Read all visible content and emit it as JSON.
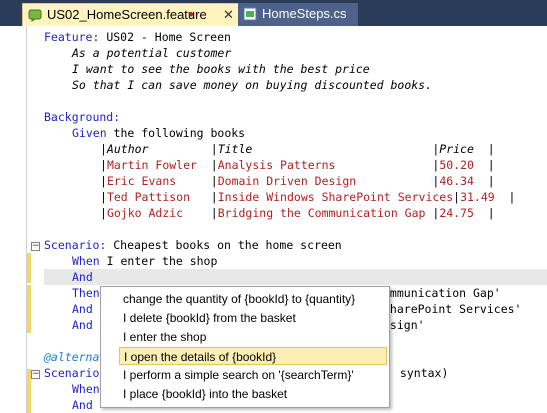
{
  "tabs": [
    {
      "label": "US02_HomeScreen.feature",
      "dirty_marker": "●",
      "close": "✕"
    },
    {
      "label": "HomeSteps.cs"
    }
  ],
  "editor": {
    "lines": [
      {
        "k1": "Feature:",
        "t1": " US02 - Home Screen"
      },
      {
        "t1": "As a potential customer"
      },
      {
        "t1": "I want to see the books with the best price"
      },
      {
        "t1": "So that I can save money on buying discounted books."
      },
      {
        "k1": "Background:"
      },
      {
        "k1": "Given",
        "t1": " the following books"
      },
      {
        "row": "|Author         |Title                          |Price  |"
      },
      {
        "r1": "Martin Fowler  ",
        "r2": "Analysis Patterns              ",
        "r3": "50.20  "
      },
      {
        "r1": "Eric Evans     ",
        "r2": "Domain Driven Design           ",
        "r3": "46.34  "
      },
      {
        "r1": "Ted Pattison   ",
        "r2": "Inside Windows SharePoint Services",
        "r3": "31.49  "
      },
      {
        "r1": "Gojko Adzic    ",
        "r2": "Bridging the Communication Gap ",
        "r3": "24.75  "
      },
      {
        "k1": "Scenario:",
        "t1": " Cheapest books on the home screen"
      },
      {
        "k1": "When",
        "t1": " I enter the shop"
      },
      {
        "k1": "And"
      },
      {
        "k1": "Then",
        "t1": "ommunication Gap'"
      },
      {
        "k1": "And",
        "t1": "SharePoint Services'"
      },
      {
        "k1": "And",
        "t1": "esign'"
      },
      {
        "tag": "@alterna"
      },
      {
        "k1": "Scenario",
        "t1": " syntax)"
      },
      {
        "k1": "When"
      },
      {
        "k1": "And"
      }
    ]
  },
  "autocomplete": {
    "items": [
      "change the quantity of {bookId} to {quantity}",
      "I delete {bookId} from the basket",
      "I enter the shop",
      "I open the details of {bookId}",
      "I perform a simple search on '{searchTerm}'",
      "I place {bookId} into the basket"
    ],
    "selected_index": 3
  }
}
